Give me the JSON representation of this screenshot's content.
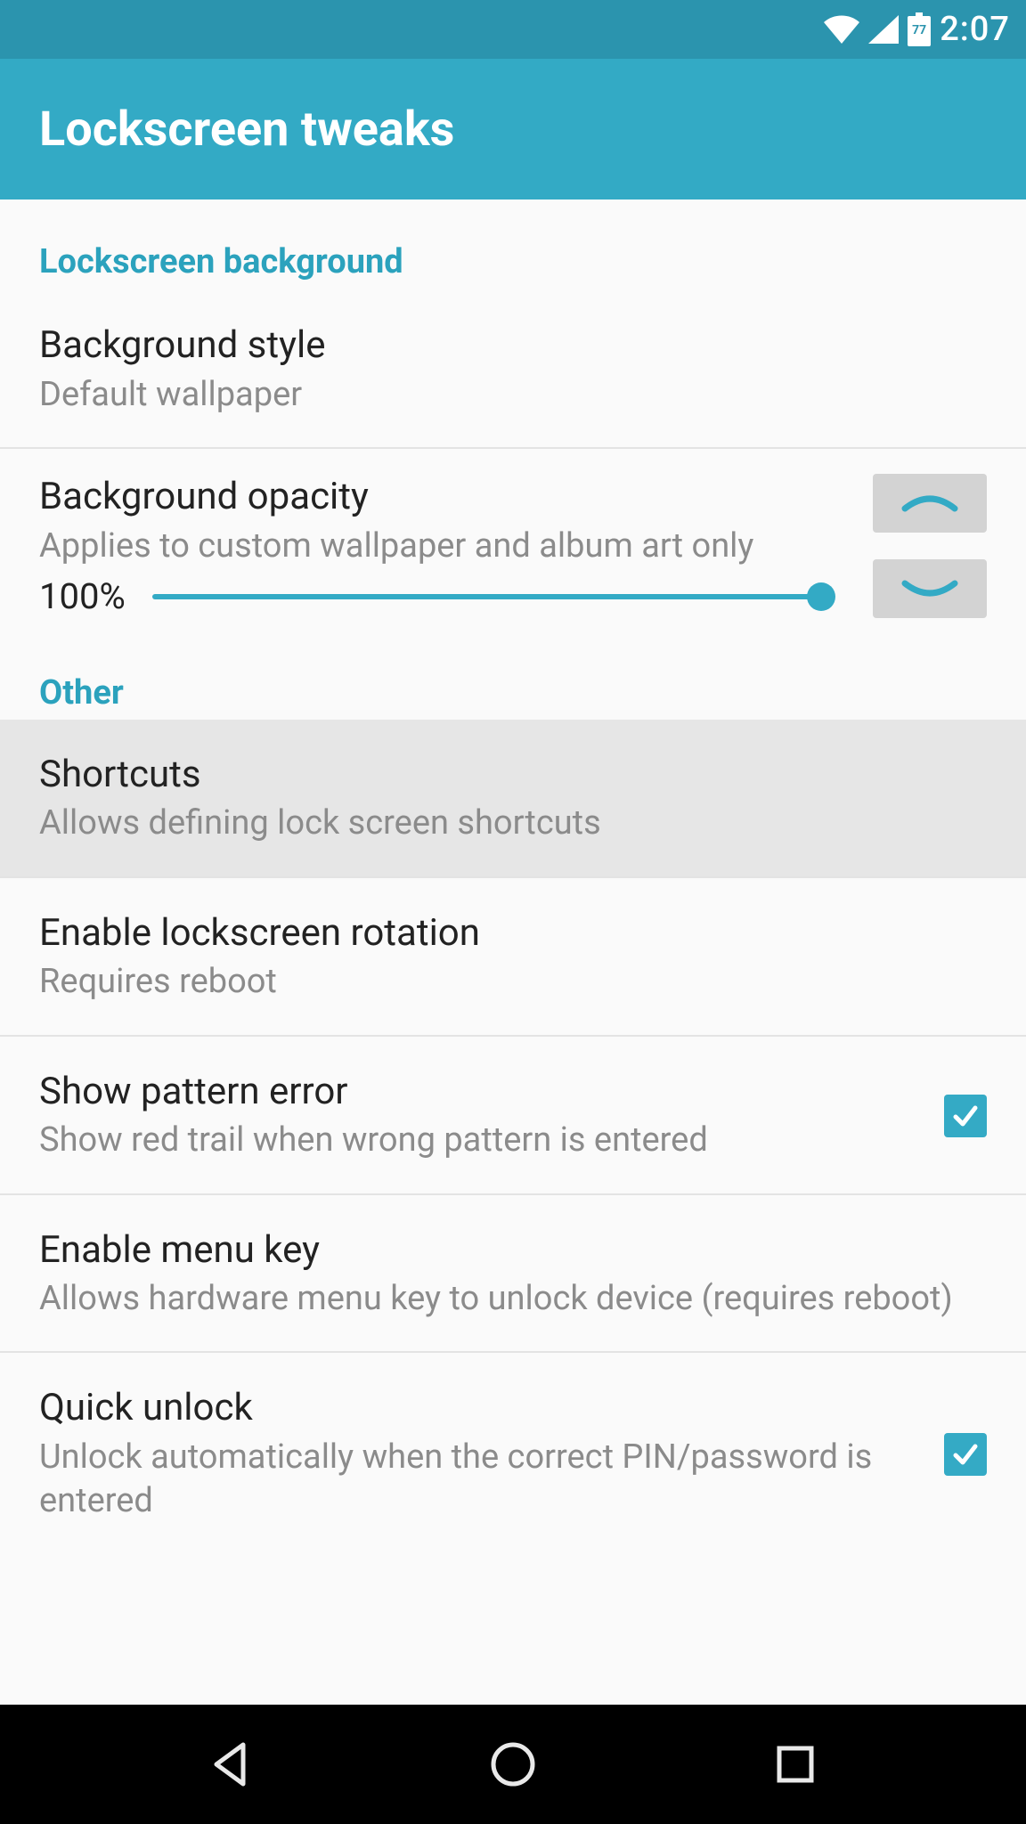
{
  "status_bar": {
    "battery_text": "77",
    "time": "2:07"
  },
  "app_bar": {
    "title": "Lockscreen tweaks"
  },
  "sections": {
    "background": {
      "header": "Lockscreen background",
      "style": {
        "title": "Background style",
        "subtitle": "Default wallpaper"
      },
      "opacity": {
        "title": "Background opacity",
        "subtitle": "Applies to custom wallpaper and album art only",
        "value_text": "100%",
        "value_percent": 100
      }
    },
    "other": {
      "header": "Other",
      "shortcuts": {
        "title": "Shortcuts",
        "subtitle": "Allows defining lock screen shortcuts"
      },
      "rotation": {
        "title": "Enable lockscreen rotation",
        "subtitle": "Requires reboot"
      },
      "pattern_error": {
        "title": "Show pattern error",
        "subtitle": "Show red trail when wrong pattern is entered",
        "checked": true
      },
      "menu_key": {
        "title": "Enable menu key",
        "subtitle": "Allows hardware menu key to unlock device (requires reboot)"
      },
      "quick_unlock": {
        "title": "Quick unlock",
        "subtitle": "Unlock automatically when the correct PIN/password is entered",
        "checked": true
      }
    }
  },
  "colors": {
    "accent": "#33aac5",
    "status_bar": "#2b94ae",
    "subtitle": "#8b8b8b"
  }
}
